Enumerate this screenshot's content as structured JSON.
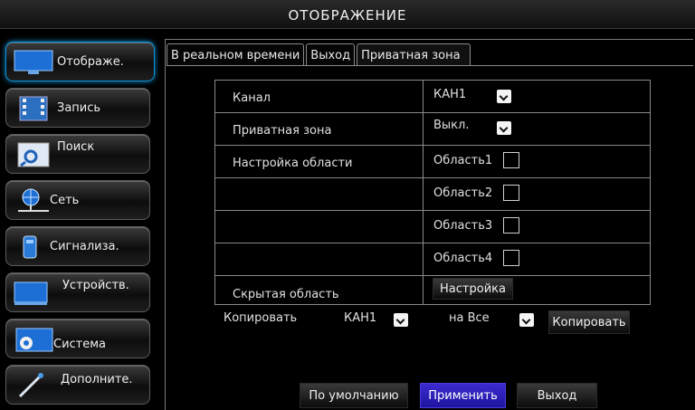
{
  "window": {
    "title": "ОТОБРАЖЕНИЕ"
  },
  "sidebar": {
    "items": [
      {
        "label": "Отображе.",
        "icon": "monitor-icon",
        "active": true
      },
      {
        "label": "Запись",
        "icon": "film-icon"
      },
      {
        "label": "Поиск",
        "icon": "magnifier-icon"
      },
      {
        "label": "Сеть",
        "icon": "network-icon"
      },
      {
        "label": "Сигнализа.",
        "icon": "alarm-icon"
      },
      {
        "label": "Устройств.",
        "icon": "device-icon"
      },
      {
        "label": "Система",
        "icon": "gear-icon"
      },
      {
        "label": "Дополните.",
        "icon": "tool-icon"
      }
    ]
  },
  "tabs": [
    {
      "label": "В реальном времени"
    },
    {
      "label": "Выход"
    },
    {
      "label": "Приватная зона",
      "active": true
    }
  ],
  "form": {
    "channel_label": "Канал",
    "channel_value": "КАН1",
    "privacy_label": "Приватная зона",
    "privacy_value": "Выкл.",
    "area_setup_label": "Настройка области",
    "areas": [
      {
        "label": "Область1",
        "checked": false
      },
      {
        "label": "Область2",
        "checked": false
      },
      {
        "label": "Область3",
        "checked": false
      },
      {
        "label": "Область4",
        "checked": false
      }
    ],
    "hidden_area_label": "Скрытая область",
    "setup_button": "Настройка"
  },
  "copy": {
    "label": "Копировать",
    "from_value": "КАН1",
    "to_label": "на Все",
    "button": "Копировать"
  },
  "footer": {
    "default_button": "По умолчанию",
    "apply_button": "Применить",
    "exit_button": "Выход"
  },
  "colors": {
    "accent": "#0a8fd0",
    "apply": "#2a1fc0"
  }
}
